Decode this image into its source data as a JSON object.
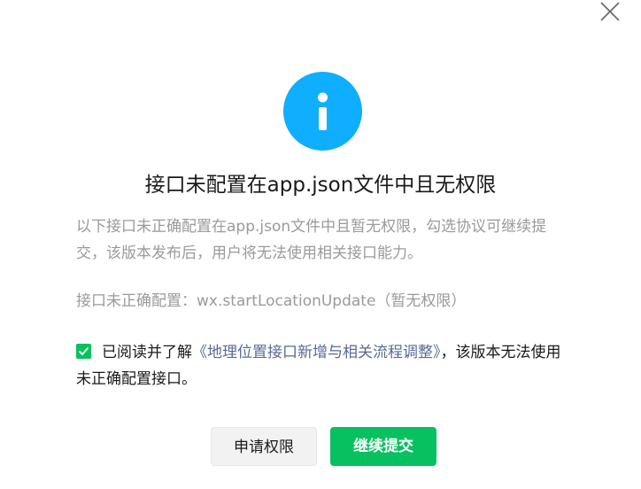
{
  "dialog": {
    "close_icon": "close-icon",
    "info_icon": "info-icon",
    "title": "接口未配置在app.json文件中且无权限",
    "description": "以下接口未正确配置在app.json文件中且暂无权限，勾选协议可继续提交，该版本发布后，用户将无法使用相关接口能力。",
    "api_line": "接口未正确配置：wx.startLocationUpdate（暂无权限）",
    "agreement": {
      "checked": true,
      "prefix": "已阅读并了解",
      "link_text": "《地理位置接口新增与相关流程调整》",
      "suffix": "，该版本无法使用未正确配置接口。"
    },
    "buttons": {
      "request_permission": "申请权限",
      "continue_submit": "继续提交"
    }
  },
  "colors": {
    "info_blue": "#10aeff",
    "primary_green": "#07c160",
    "link_blue": "#576b95",
    "muted_text": "#9a9a9a"
  }
}
